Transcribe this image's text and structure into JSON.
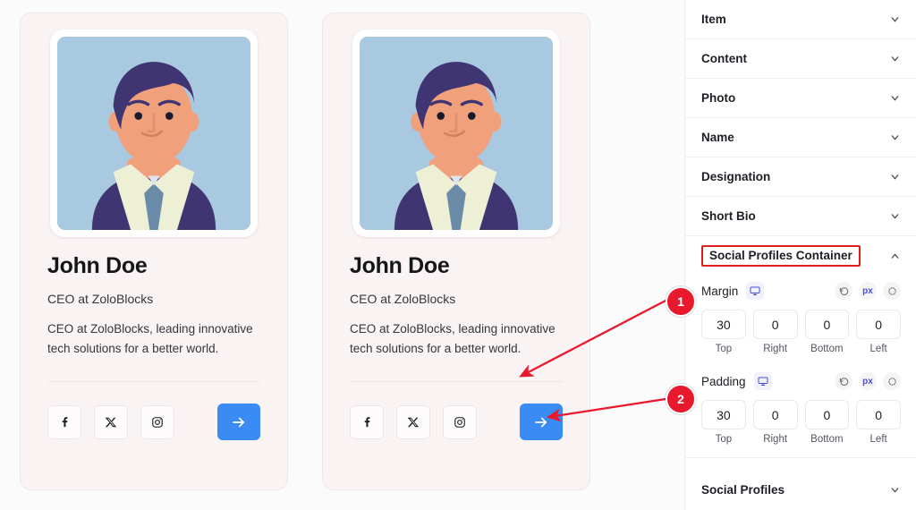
{
  "canvas": {
    "background_color": "#fbfbfb",
    "cards": [
      {
        "name": "John Doe",
        "designation": "CEO at ZoloBlocks",
        "bio": "CEO at ZoloBlocks, leading innovative tech solutions for a better world.",
        "socials": [
          "facebook-icon",
          "x-twitter-icon",
          "instagram-icon"
        ],
        "cta_icon": "arrow-right-icon",
        "avatar_alt": "illustrated-male-avatar"
      },
      {
        "name": "John Doe",
        "designation": "CEO at ZoloBlocks",
        "bio": "CEO at ZoloBlocks, leading innovative tech solutions for a better world.",
        "socials": [
          "facebook-icon",
          "x-twitter-icon",
          "instagram-icon"
        ],
        "cta_icon": "arrow-right-icon",
        "avatar_alt": "illustrated-male-avatar"
      }
    ]
  },
  "sidebar": {
    "accordions_top": [
      {
        "label": "Item",
        "state": "collapsed",
        "icon": "chevron-down-icon"
      },
      {
        "label": "Content",
        "state": "collapsed",
        "icon": "chevron-down-icon"
      },
      {
        "label": "Photo",
        "state": "collapsed",
        "icon": "chevron-down-icon"
      },
      {
        "label": "Name",
        "state": "collapsed",
        "icon": "chevron-down-icon"
      },
      {
        "label": "Designation",
        "state": "collapsed",
        "icon": "chevron-down-icon"
      },
      {
        "label": "Short Bio",
        "state": "collapsed",
        "icon": "chevron-down-icon"
      }
    ],
    "active_accordion": {
      "label": "Social Profiles Container",
      "state": "expanded",
      "icon": "chevron-up-icon",
      "highlight_color": "#e02020"
    },
    "spacing_controls": [
      {
        "label": "Margin",
        "device_icon": "desktop-icon",
        "unit": "px",
        "reset_icon": "reset-icon",
        "link_icon": "link-sides-icon",
        "sides": [
          {
            "caption": "Top",
            "value": "30"
          },
          {
            "caption": "Right",
            "value": "0"
          },
          {
            "caption": "Bottom",
            "value": "0"
          },
          {
            "caption": "Left",
            "value": "0"
          }
        ]
      },
      {
        "label": "Padding",
        "device_icon": "desktop-icon",
        "unit": "px",
        "reset_icon": "reset-icon",
        "link_icon": "link-sides-icon",
        "sides": [
          {
            "caption": "Top",
            "value": "30"
          },
          {
            "caption": "Right",
            "value": "0"
          },
          {
            "caption": "Bottom",
            "value": "0"
          },
          {
            "caption": "Left",
            "value": "0"
          }
        ]
      }
    ],
    "accordions_bottom": [
      {
        "label": "Social Profiles",
        "state": "collapsed",
        "icon": "chevron-down-icon"
      }
    ]
  },
  "annotations": {
    "accent_color": "#e8192c",
    "markers": [
      {
        "number": "1",
        "points_to": "card-2-margin-area"
      },
      {
        "number": "2",
        "points_to": "card-2-padding-area"
      }
    ]
  }
}
